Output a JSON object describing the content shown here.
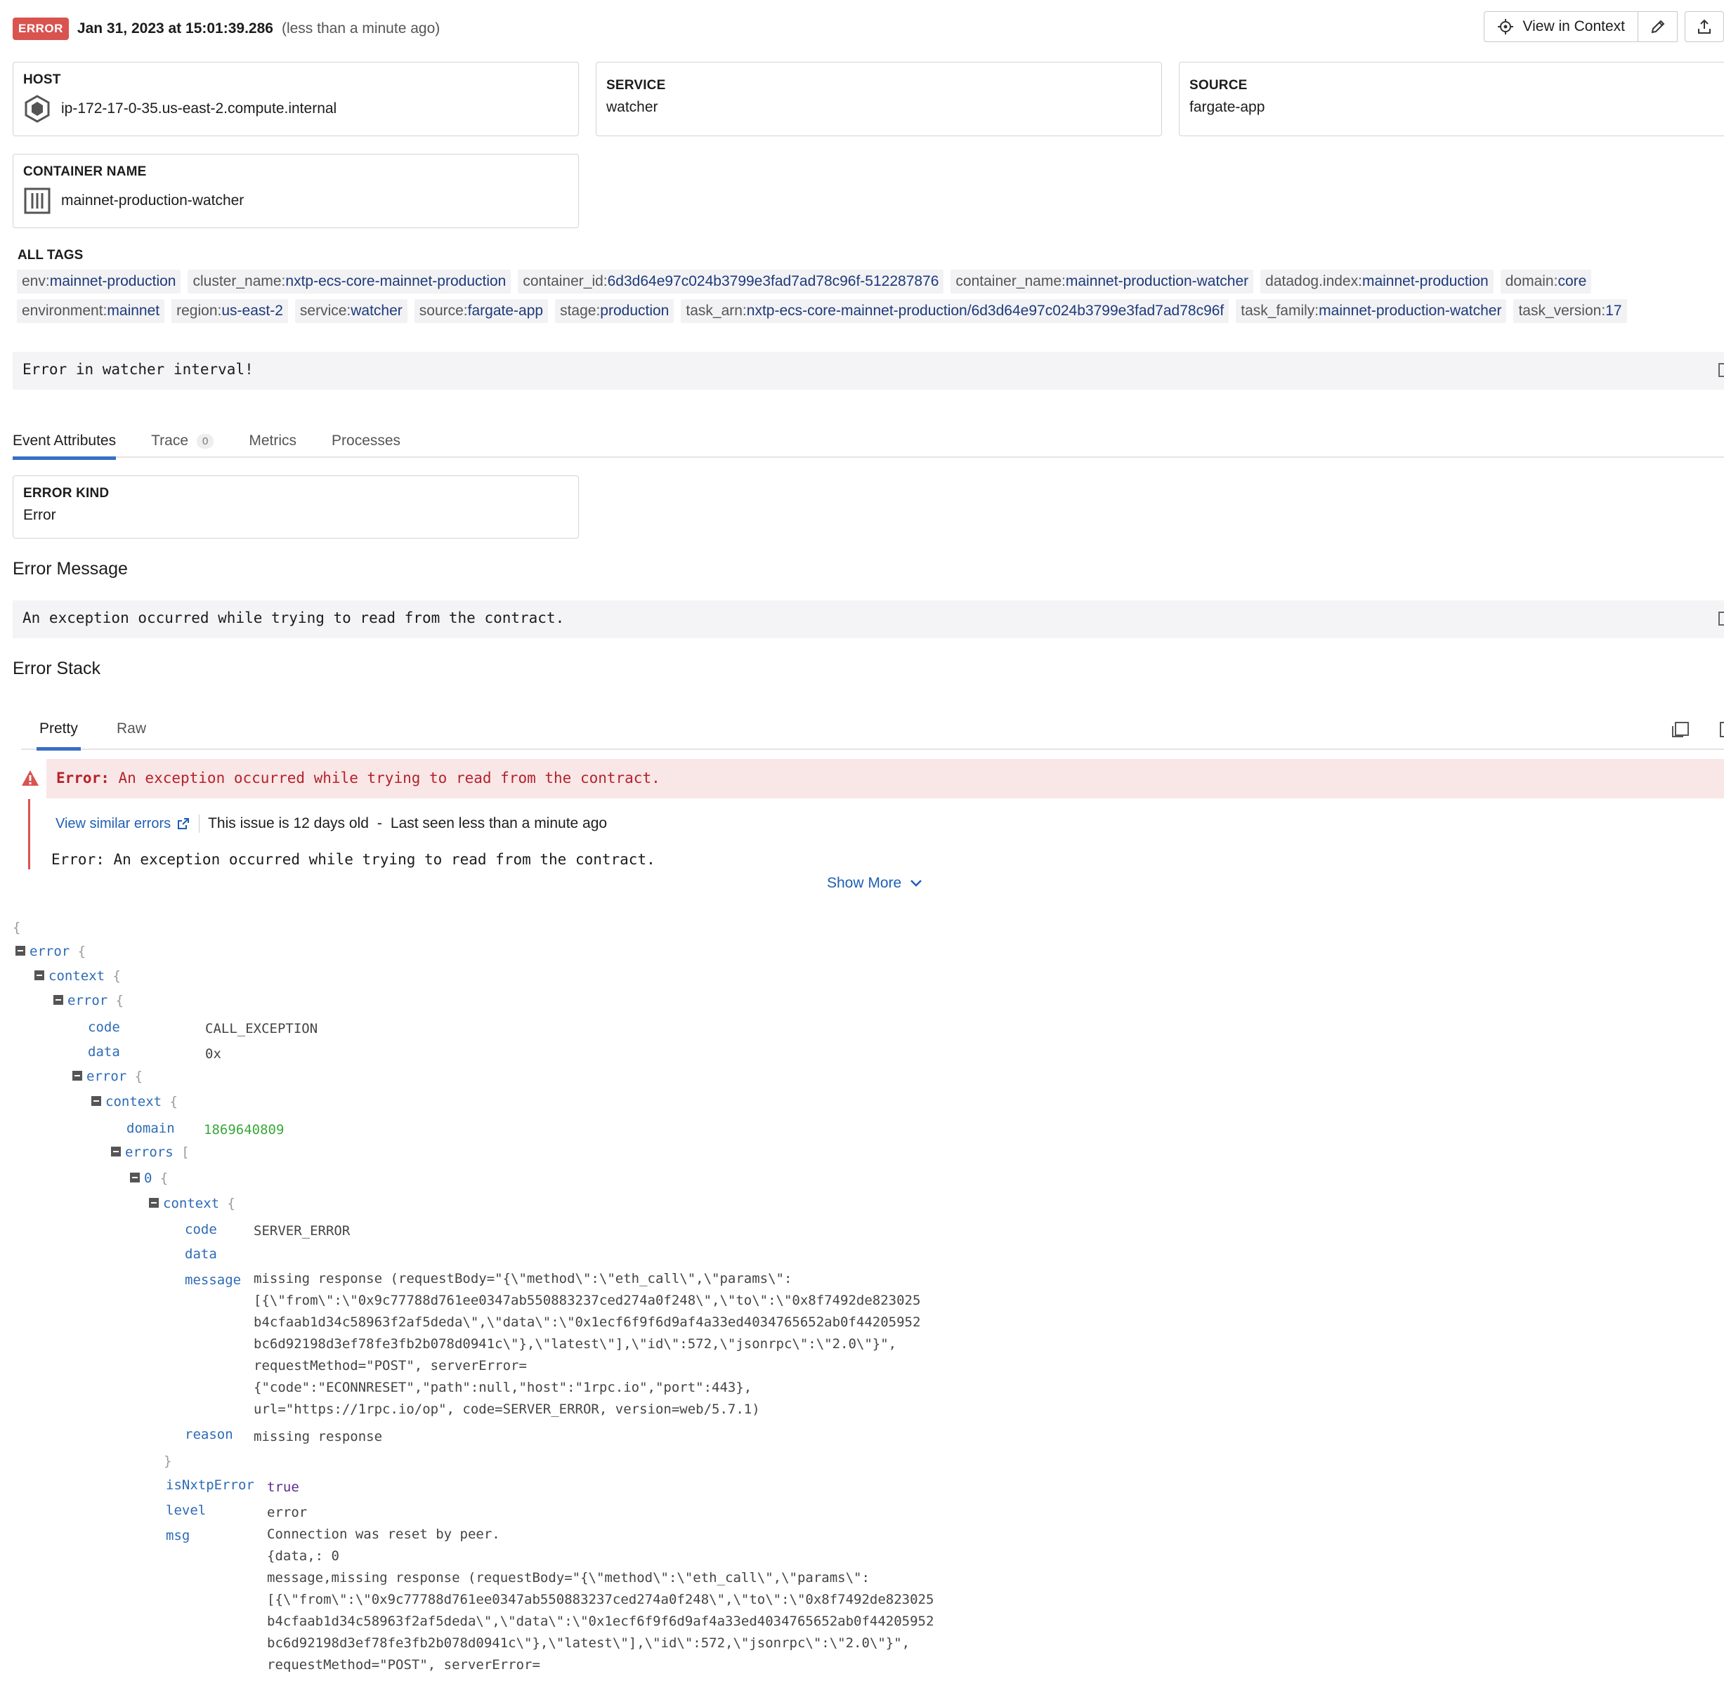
{
  "header": {
    "level": "ERROR",
    "timestamp": "Jan 31, 2023 at 15:01:39.286",
    "relative": "(less than a minute ago)",
    "view_context_label": "View in Context"
  },
  "attributes": {
    "host": {
      "label": "HOST",
      "value": "ip-172-17-0-35.us-east-2.compute.internal"
    },
    "service": {
      "label": "SERVICE",
      "value": "watcher"
    },
    "source": {
      "label": "SOURCE",
      "value": "fargate-app"
    },
    "container": {
      "label": "CONTAINER NAME",
      "value": "mainnet-production-watcher"
    }
  },
  "tags_title": "ALL TAGS",
  "tags": [
    {
      "k": "env:",
      "v": "mainnet-production"
    },
    {
      "k": "cluster_name:",
      "v": "nxtp-ecs-core-mainnet-production"
    },
    {
      "k": "container_id:",
      "v": "6d3d64e97c024b3799e3fad7ad78c96f-512287876"
    },
    {
      "k": "container_name:",
      "v": "mainnet-production-watcher"
    },
    {
      "k": "datadog.index:",
      "v": "mainnet-production"
    },
    {
      "k": "domain:",
      "v": "core"
    },
    {
      "k": "environment:",
      "v": "mainnet"
    },
    {
      "k": "region:",
      "v": "us-east-2"
    },
    {
      "k": "service:",
      "v": "watcher"
    },
    {
      "k": "source:",
      "v": "fargate-app"
    },
    {
      "k": "stage:",
      "v": "production"
    },
    {
      "k": "task_arn:",
      "v": "nxtp-ecs-core-mainnet-production/6d3d64e97c024b3799e3fad7ad78c96f"
    },
    {
      "k": "task_family:",
      "v": "mainnet-production-watcher"
    },
    {
      "k": "task_version:",
      "v": "17"
    }
  ],
  "message": "Error in watcher interval!",
  "tabs": {
    "event_attributes": "Event Attributes",
    "trace": "Trace",
    "trace_count": "0",
    "metrics": "Metrics",
    "processes": "Processes"
  },
  "error_kind": {
    "label": "ERROR KIND",
    "value": "Error"
  },
  "error_message": {
    "title": "Error Message",
    "text": "An exception occurred while trying to read from the contract."
  },
  "error_stack": {
    "title": "Error Stack",
    "tab_pretty": "Pretty",
    "tab_raw": "Raw",
    "banner_prefix": "Error:",
    "banner_text": " An exception occurred while trying to read from the contract.",
    "view_similar": "View similar errors",
    "issue_age": "This issue is 12 days old",
    "last_seen": "Last seen less than a minute ago",
    "plain": "Error: An exception occurred while trying to read from the contract.",
    "show_more": "Show More"
  },
  "json_tree": {
    "open_brace": "{",
    "k_error": "error",
    "k_context": "context",
    "k_error2": "error",
    "k_code": "code",
    "v_code": "CALL_EXCEPTION",
    "k_data": "data",
    "v_data": "0x",
    "k_error3": "error",
    "k_context2": "context",
    "k_domain": "domain",
    "v_domain": "1869640809",
    "k_errors": "errors",
    "k_zero": "0",
    "k_context3": "context",
    "k_code2": "code",
    "v_code2": "SERVER_ERROR",
    "k_data2": "data",
    "k_message": "message",
    "v_message": "missing response (requestBody=\"{\\\"method\\\":\\\"eth_call\\\",\\\"params\\\":\n[{\\\"from\\\":\\\"0x9c77788d761ee0347ab550883237ced274a0f248\\\",\\\"to\\\":\\\"0x8f7492de823025\nb4cfaab1d34c58963f2af5deda\\\",\\\"data\\\":\\\"0x1ecf6f9f6d9af4a33ed4034765652ab0f44205952\nbc6d92198d3ef78fe3fb2b078d0941c\\\"},\\\"latest\\\"],\\\"id\\\":572,\\\"jsonrpc\\\":\\\"2.0\\\"}\",\nrequestMethod=\"POST\", serverError=\n{\"code\":\"ECONNRESET\",\"path\":null,\"host\":\"1rpc.io\",\"port\":443},\nurl=\"https://1rpc.io/op\", code=SERVER_ERROR, version=web/5.7.1)",
    "k_reason": "reason",
    "v_reason": "missing response",
    "k_isnxtp": "isNxtpError",
    "v_isnxtp": "true",
    "k_level": "level",
    "v_level": "error",
    "k_msg": "msg",
    "v_msg": "Connection was reset by peer.\n{data,: 0\nmessage,missing response (requestBody=\"{\\\"method\\\":\\\"eth_call\\\",\\\"params\\\":\n[{\\\"from\\\":\\\"0x9c77788d761ee0347ab550883237ced274a0f248\\\",\\\"to\\\":\\\"0x8f7492de823025\nb4cfaab1d34c58963f2af5deda\\\",\\\"data\\\":\\\"0x1ecf6f9f6d9af4a33ed4034765652ab0f44205952\nbc6d92198d3ef78fe3fb2b078d0941c\\\"},\\\"latest\\\"],\\\"id\\\":572,\\\"jsonrpc\\\":\\\"2.0\\\"}\",\nrequestMethod=\"POST\", serverError="
  },
  "colors": {
    "error_badge": "#d9534f",
    "link": "#1f5fb5",
    "tab_active": "#3a6ec5",
    "json_key": "#2d6bb5",
    "json_number": "#3aa83a",
    "json_bool": "#5b2d91"
  }
}
